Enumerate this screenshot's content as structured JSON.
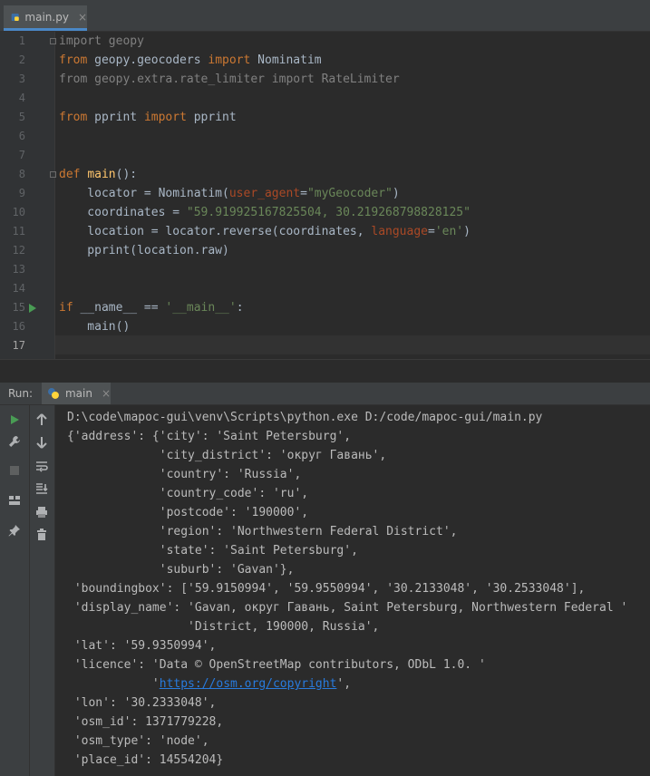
{
  "editor_tab": {
    "filename": "main.py",
    "close": "×"
  },
  "code_lines": [
    {
      "n": "1",
      "html": "<span class=\"dim\">import geopy</span>"
    },
    {
      "n": "2",
      "html": "<span class=\"kw\">from</span> geopy.geocoders <span class=\"kw\">import</span> Nominatim"
    },
    {
      "n": "3",
      "html": "<span class=\"dim\">from geopy.extra.rate_limiter import RateLimiter</span>"
    },
    {
      "n": "4",
      "html": ""
    },
    {
      "n": "5",
      "html": "<span class=\"kw\">from</span> pprint <span class=\"kw\">import</span> pprint"
    },
    {
      "n": "6",
      "html": ""
    },
    {
      "n": "7",
      "html": ""
    },
    {
      "n": "8",
      "html": "<span class=\"kw\">def</span> <span class=\"fn\">main</span>():"
    },
    {
      "n": "9",
      "html": "    locator = Nominatim(<span class=\"param\">user_agent</span>=<span class=\"str\">\"myGeocoder\"</span>)"
    },
    {
      "n": "10",
      "html": "    coordinates = <span class=\"str\">\"59.919925167825504, 30.219268798828125\"</span>"
    },
    {
      "n": "11",
      "html": "    location = locator.reverse(coordinates, <span class=\"param\">language</span>=<span class=\"str\">'en'</span>)"
    },
    {
      "n": "12",
      "html": "    pprint(location.raw)"
    },
    {
      "n": "13",
      "html": ""
    },
    {
      "n": "14",
      "html": ""
    },
    {
      "n": "15",
      "html": "<span class=\"kw\">if</span> __name__ == <span class=\"str\">'__main__'</span>:"
    },
    {
      "n": "16",
      "html": "    main()"
    },
    {
      "n": "17",
      "html": ""
    }
  ],
  "run_panel": {
    "label": "Run:",
    "tab_name": "main",
    "close": "×"
  },
  "console_lines": [
    "D:\\code\\mapoc-gui\\venv\\Scripts\\python.exe D:/code/mapoc-gui/main.py",
    "{'address': {'city': 'Saint Petersburg',",
    "             'city_district': 'округ Гавань',",
    "             'country': 'Russia',",
    "             'country_code': 'ru',",
    "             'postcode': '190000',",
    "             'region': 'Northwestern Federal District',",
    "             'state': 'Saint Petersburg',",
    "             'suburb': 'Gavan'},",
    " 'boundingbox': ['59.9150994', '59.9550994', '30.2133048', '30.2533048'],",
    " 'display_name': 'Gavan, округ Гавань, Saint Petersburg, Northwestern Federal '",
    "                 'District, 190000, Russia',",
    " 'lat': '59.9350994',",
    " 'licence': 'Data © OpenStreetMap contributors, ODbL 1.0. '",
    "            '",
    " 'lon': '30.2333048',",
    " 'osm_id': 1371779228,",
    " 'osm_type': 'node',",
    " 'place_id': 14554204}"
  ],
  "licence_link": "https://osm.org/copyright",
  "licence_link_suffix": "',",
  "toolbar_icons": [
    "run-icon",
    "wrench-icon",
    "stop-icon",
    "layout-icon",
    "pin-icon",
    "up-arrow-icon",
    "down-arrow-icon",
    "soft-wrap-icon",
    "scroll-to-end-icon",
    "print-icon",
    "trash-icon"
  ]
}
